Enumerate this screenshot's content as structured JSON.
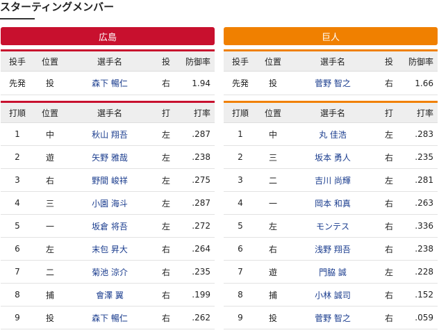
{
  "title": "スターティングメンバー",
  "colors": {
    "home": "#c8102e",
    "away": "#f08000",
    "link": "#1a3c8e"
  },
  "pitcher_headers": [
    "投手",
    "位置",
    "選手名",
    "投",
    "防御率"
  ],
  "batter_headers": [
    "打順",
    "位置",
    "選手名",
    "打",
    "打率"
  ],
  "teams": [
    {
      "name": "広島",
      "pitcher": {
        "role": "先発",
        "pos": "投",
        "player": "森下 暢仁",
        "hand": "右",
        "era": "1.94"
      },
      "batters": [
        {
          "order": "1",
          "pos": "中",
          "player": "秋山 翔吾",
          "hand": "左",
          "avg": ".287"
        },
        {
          "order": "2",
          "pos": "遊",
          "player": "矢野 雅哉",
          "hand": "左",
          "avg": ".238"
        },
        {
          "order": "3",
          "pos": "右",
          "player": "野間 峻祥",
          "hand": "左",
          "avg": ".275"
        },
        {
          "order": "4",
          "pos": "三",
          "player": "小園 海斗",
          "hand": "左",
          "avg": ".287"
        },
        {
          "order": "5",
          "pos": "一",
          "player": "坂倉 将吾",
          "hand": "左",
          "avg": ".272"
        },
        {
          "order": "6",
          "pos": "左",
          "player": "末包 昇大",
          "hand": "右",
          "avg": ".264"
        },
        {
          "order": "7",
          "pos": "二",
          "player": "菊池 涼介",
          "hand": "右",
          "avg": ".235"
        },
        {
          "order": "8",
          "pos": "捕",
          "player": "會澤 翼",
          "hand": "右",
          "avg": ".199"
        },
        {
          "order": "9",
          "pos": "投",
          "player": "森下 暢仁",
          "hand": "右",
          "avg": ".262"
        }
      ]
    },
    {
      "name": "巨人",
      "pitcher": {
        "role": "先発",
        "pos": "投",
        "player": "菅野 智之",
        "hand": "右",
        "era": "1.66"
      },
      "batters": [
        {
          "order": "1",
          "pos": "中",
          "player": "丸 佳浩",
          "hand": "左",
          "avg": ".283"
        },
        {
          "order": "2",
          "pos": "三",
          "player": "坂本 勇人",
          "hand": "右",
          "avg": ".235"
        },
        {
          "order": "3",
          "pos": "二",
          "player": "吉川 尚輝",
          "hand": "左",
          "avg": ".281"
        },
        {
          "order": "4",
          "pos": "一",
          "player": "岡本 和真",
          "hand": "右",
          "avg": ".263"
        },
        {
          "order": "5",
          "pos": "左",
          "player": "モンテス",
          "hand": "右",
          "avg": ".336"
        },
        {
          "order": "6",
          "pos": "右",
          "player": "浅野 翔吾",
          "hand": "右",
          "avg": ".238"
        },
        {
          "order": "7",
          "pos": "遊",
          "player": "門脇 誠",
          "hand": "左",
          "avg": ".228"
        },
        {
          "order": "8",
          "pos": "捕",
          "player": "小林 誠司",
          "hand": "右",
          "avg": ".152"
        },
        {
          "order": "9",
          "pos": "投",
          "player": "菅野 智之",
          "hand": "右",
          "avg": ".059"
        }
      ]
    }
  ]
}
